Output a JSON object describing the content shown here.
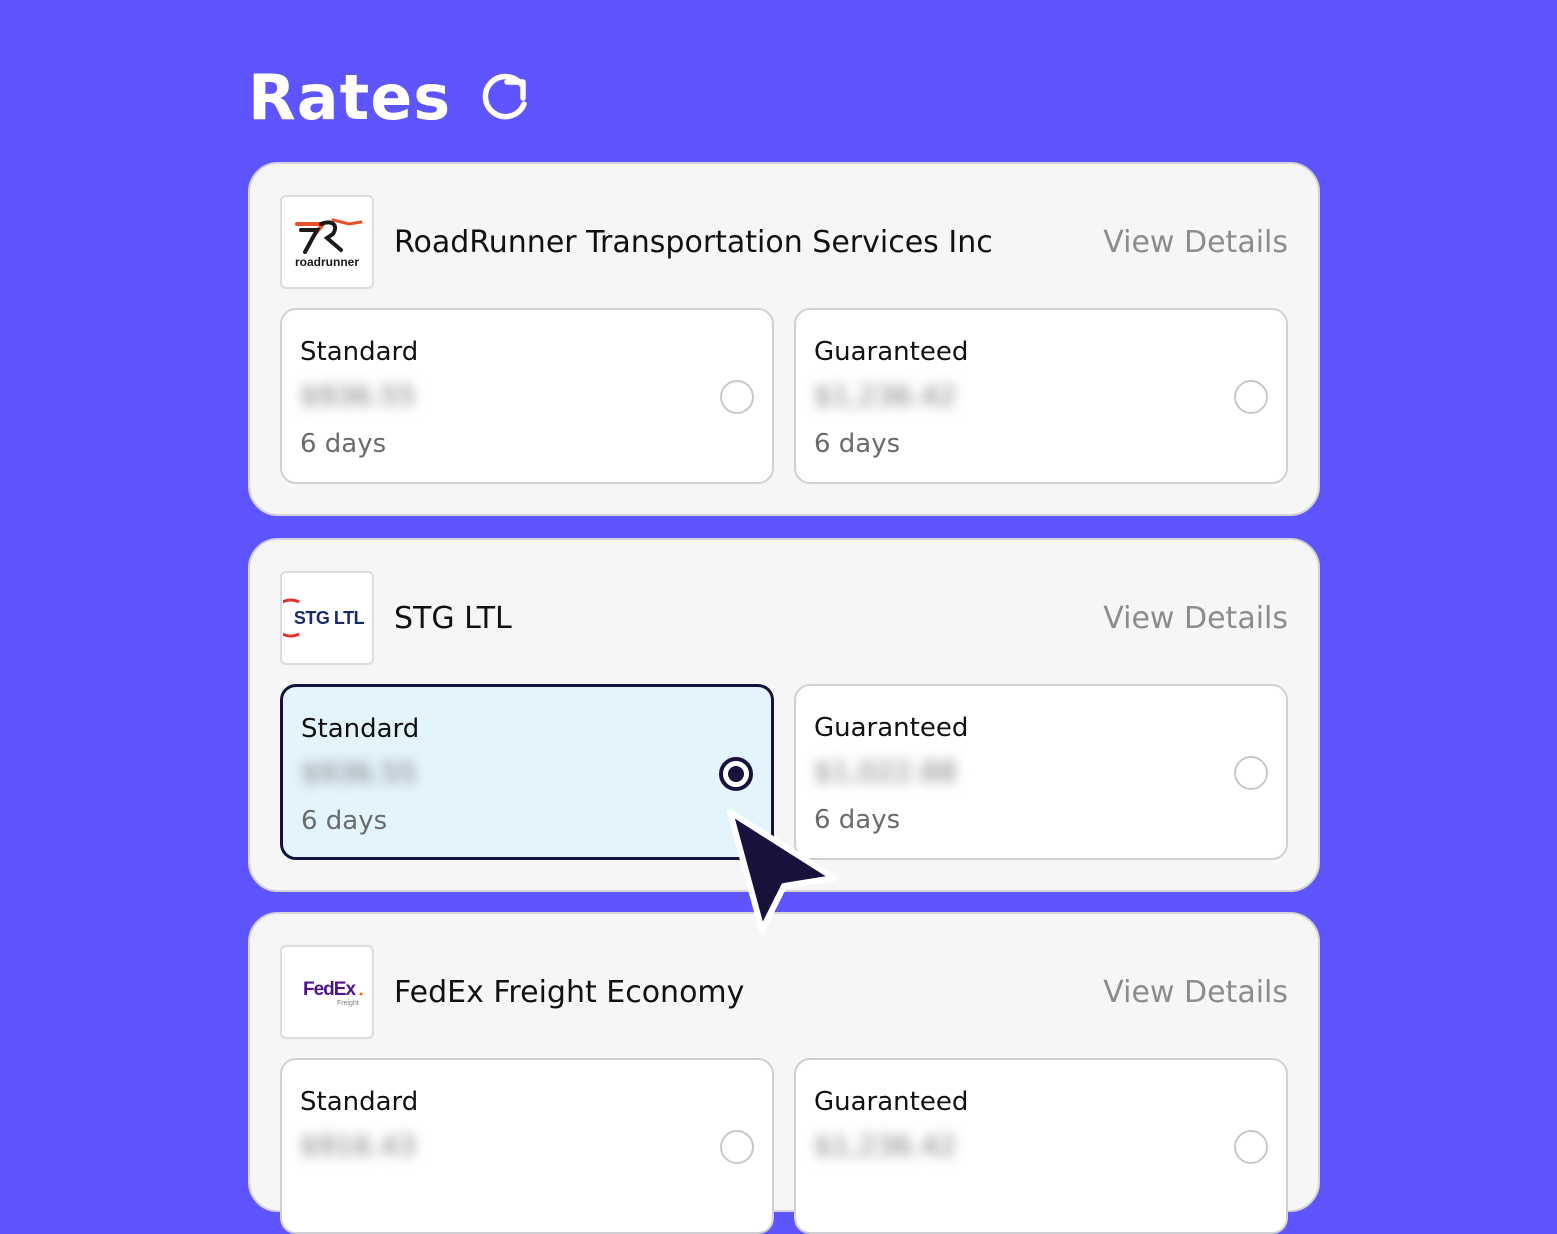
{
  "page": {
    "title": "Rates",
    "refresh_icon": "refresh-icon"
  },
  "carriers": [
    {
      "name": "RoadRunner Transportation Services Inc",
      "logo": {
        "icon": "roadrunner-logo",
        "text": "roadrunner"
      },
      "view_details": "View Details",
      "options": [
        {
          "label": "Standard",
          "price": "$936.55",
          "days": "6 days",
          "selected": false
        },
        {
          "label": "Guaranteed",
          "price": "$1,236.42",
          "days": "6 days",
          "selected": false
        }
      ]
    },
    {
      "name": "STG LTL",
      "logo": {
        "icon": "stg-ltl-logo",
        "text": "STG LTL"
      },
      "view_details": "View Details",
      "options": [
        {
          "label": "Standard",
          "price": "$936.55",
          "days": "6 days",
          "selected": true
        },
        {
          "label": "Guaranteed",
          "price": "$1,022.88",
          "days": "6 days",
          "selected": false
        }
      ]
    },
    {
      "name": "FedEx Freight Economy",
      "logo": {
        "icon": "fedex-freight-logo",
        "text": "FedEx",
        "subtext": "Freight"
      },
      "view_details": "View Details",
      "options": [
        {
          "label": "Standard",
          "price": "$916.43",
          "days": "",
          "selected": false
        },
        {
          "label": "Guaranteed",
          "price": "$1,236.42",
          "days": "",
          "selected": false
        }
      ]
    }
  ],
  "colors": {
    "background": "#5f55fe",
    "card": "#f6f6f6",
    "selected_option": "#e4f4fd",
    "selected_border": "#16123c",
    "muted_text": "#8c8c8c"
  }
}
